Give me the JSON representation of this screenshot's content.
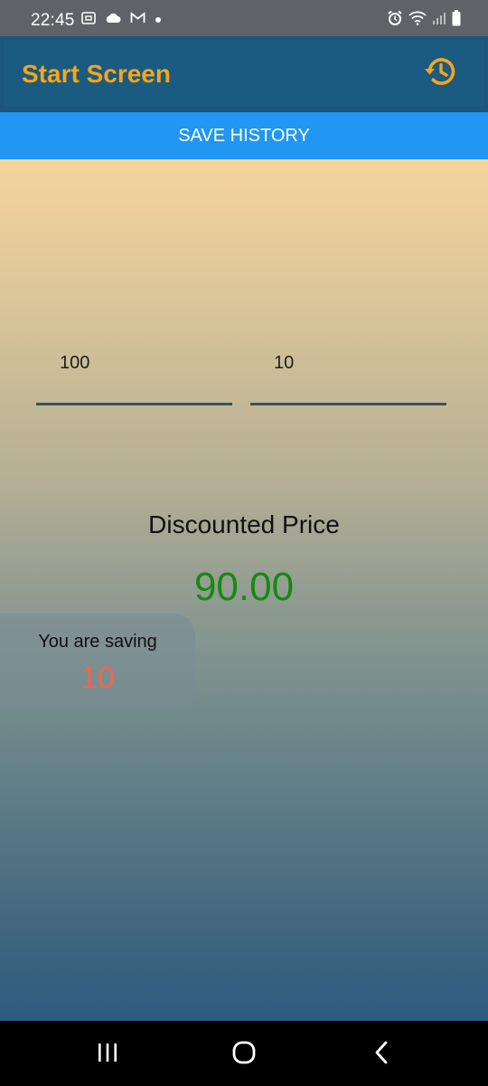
{
  "status_bar": {
    "time": "22:45",
    "left_icons": [
      "screenshot-icon",
      "cloud-icon",
      "gmail-icon",
      "dot-icon"
    ],
    "right_icons": [
      "alarm-icon",
      "wifi-icon",
      "signal-icon",
      "battery-icon"
    ]
  },
  "app_bar": {
    "title": "Start Screen",
    "action_icon": "history-icon",
    "accent_color": "#f7a51b",
    "background_color": "#1b5a81"
  },
  "save_button": {
    "label": "SAVE HISTORY",
    "color": "#2196f3"
  },
  "inputs": {
    "price": {
      "value": "100"
    },
    "discount": {
      "value": "10"
    }
  },
  "result": {
    "label": "Discounted Price",
    "value": "90.00",
    "value_color": "#168a10"
  },
  "saving": {
    "label": "You are saving",
    "value": "10",
    "value_color": "#f0664a"
  },
  "nav_bar": {
    "buttons": [
      "recents-icon",
      "home-icon",
      "back-icon"
    ]
  }
}
